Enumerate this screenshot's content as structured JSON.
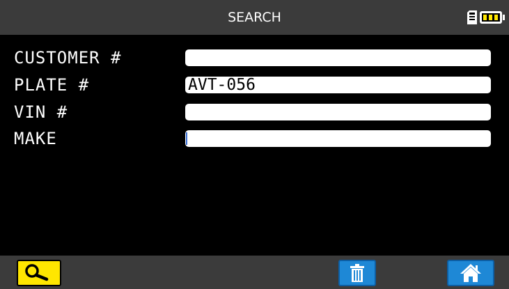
{
  "header": {
    "title": "SEARCH",
    "status_icons": [
      "sd-card-icon",
      "battery-icon"
    ]
  },
  "form": {
    "fields": [
      {
        "label": "CUSTOMER #",
        "value": ""
      },
      {
        "label": "PLATE #",
        "value": "AVT-056"
      },
      {
        "label": "VIN #",
        "value": ""
      },
      {
        "label": "MAKE",
        "value": ""
      }
    ],
    "active_field": "MAKE"
  },
  "toolbar": {
    "buttons": [
      {
        "icon": "magnifier-icon",
        "color": "#ffe600"
      },
      {
        "icon": "trash-icon",
        "color": "#1e88d6"
      },
      {
        "icon": "home-icon",
        "color": "#1e88d6"
      }
    ]
  },
  "colors": {
    "background": "#000000",
    "bar": "#3b3b3b",
    "accent_yellow": "#ffe600",
    "accent_blue": "#1e88d6",
    "text": "#ffffff"
  }
}
